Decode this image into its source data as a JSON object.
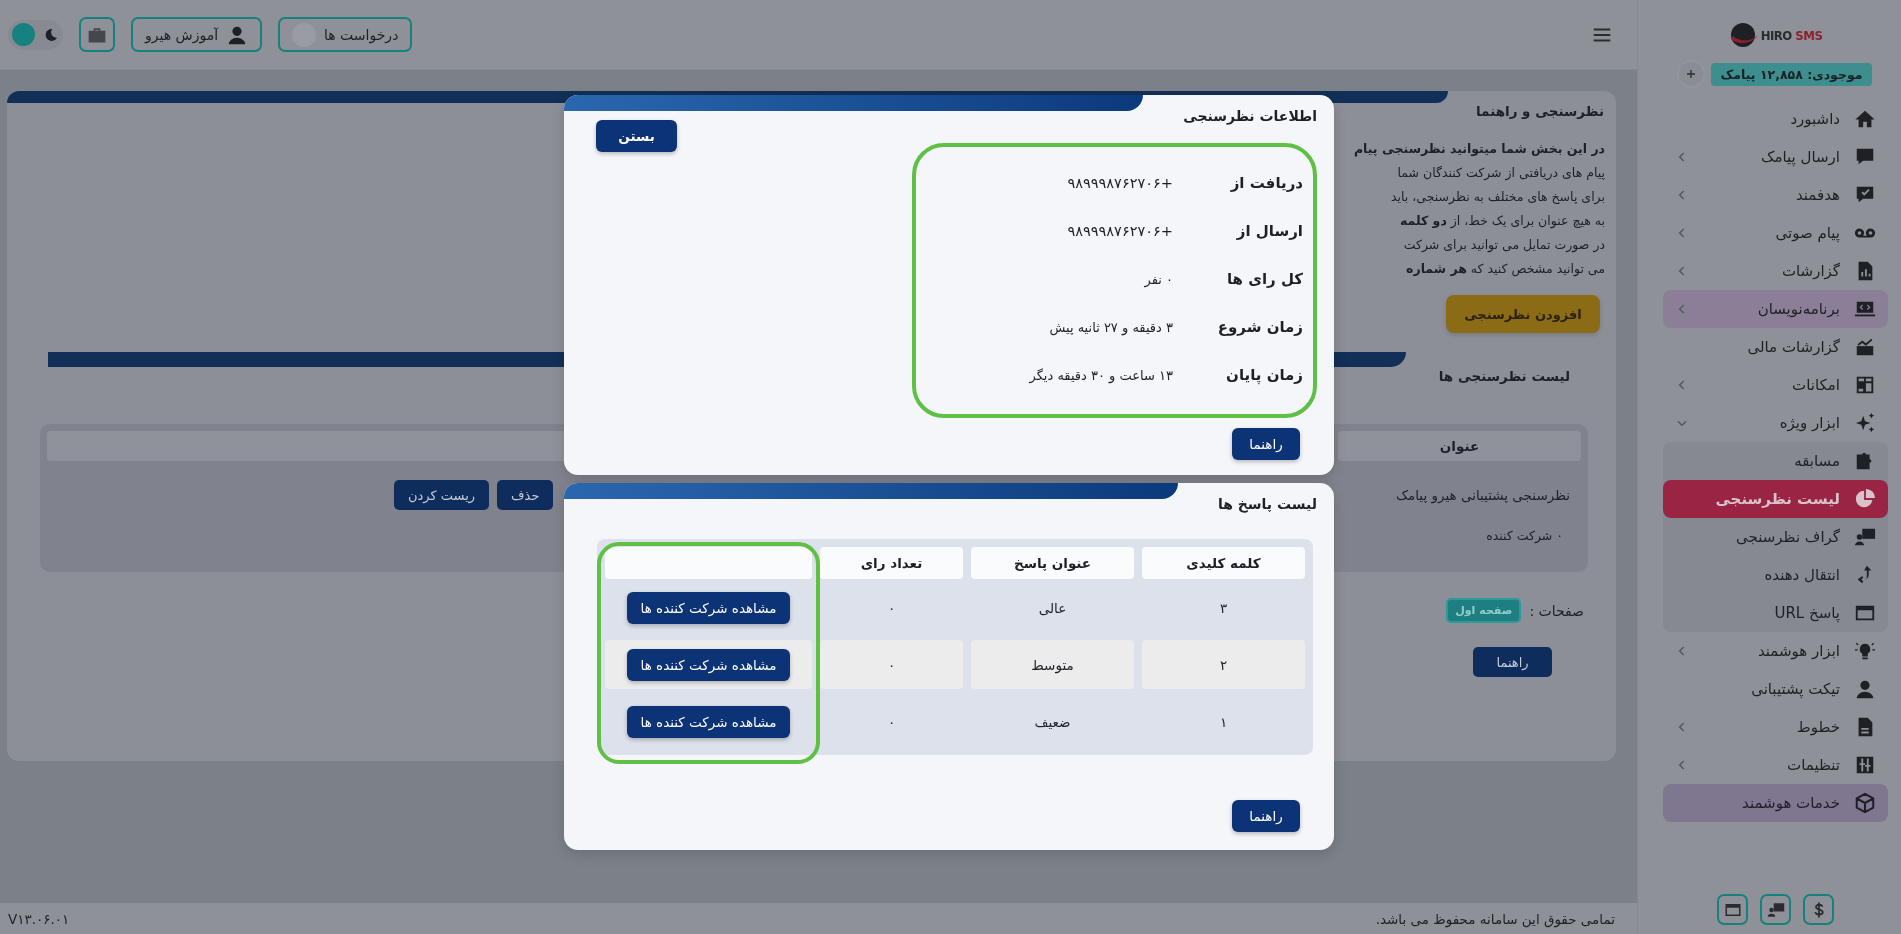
{
  "topbar": {
    "theme_toggle_on": false,
    "requests_button": "درخواست ها",
    "tutorial_button": "آموزش هیرو"
  },
  "sidebar": {
    "brand": "HIRO",
    "brand_accent": "SMS",
    "balance": "موجودی: ۱۲,۸۵۸ پیامک",
    "items": [
      {
        "label": "داشبورد",
        "has_submenu": false,
        "selected": false,
        "highlighted": false
      },
      {
        "label": "ارسال پیامک",
        "has_submenu": true,
        "expanded": false,
        "selected": false,
        "highlighted": false
      },
      {
        "label": "هدفمند",
        "has_submenu": true,
        "expanded": false,
        "selected": false,
        "highlighted": false
      },
      {
        "label": "پیام صوتی",
        "has_submenu": true,
        "expanded": false,
        "selected": false,
        "highlighted": false
      },
      {
        "label": "گزارشات",
        "has_submenu": true,
        "expanded": false,
        "selected": false,
        "highlighted": false
      },
      {
        "label": "برنامه‌نویسان",
        "has_submenu": true,
        "expanded": false,
        "selected": false,
        "highlighted": true
      },
      {
        "label": "گزارشات مالی",
        "has_submenu": false,
        "selected": false,
        "highlighted": false
      },
      {
        "label": "امکانات",
        "has_submenu": true,
        "expanded": false,
        "selected": false,
        "highlighted": false
      },
      {
        "label": "ابزار ویژه",
        "has_submenu": true,
        "expanded": true,
        "selected": false,
        "highlighted": false,
        "children": [
          {
            "label": "مسابقه",
            "selected": false
          },
          {
            "label": "لیست نظرسنجی",
            "selected": true
          },
          {
            "label": "گراف نظرسنجی",
            "selected": false
          },
          {
            "label": "انتقال دهنده",
            "selected": false
          },
          {
            "label": "پاسخ URL",
            "selected": false
          }
        ]
      },
      {
        "label": "ابزار هوشمند",
        "has_submenu": true,
        "expanded": false,
        "selected": false,
        "highlighted": false
      },
      {
        "label": "تیکت پشتیبانی",
        "has_submenu": false,
        "selected": false,
        "highlighted": false
      },
      {
        "label": "خطوط",
        "has_submenu": true,
        "expanded": false,
        "selected": false,
        "highlighted": false
      },
      {
        "label": "تنظیمات",
        "has_submenu": true,
        "expanded": false,
        "selected": false,
        "highlighted": false
      },
      {
        "label": "خدمات هوشمند",
        "has_submenu": false,
        "selected": false,
        "highlighted": true
      }
    ]
  },
  "page": {
    "title": "نظرسنجی و راهنما",
    "intro_lines": [
      "**در این بخش شما میتوانید نظرسنجی پیام**",
      "پیام های دریافتی از شرکت کنندگان شما",
      "برای پاسخ های مختلف به نظرسنجی، باید",
      "به هیچ عنوان برای یک خط، از **دو کلمه**",
      "در صورت تمایل می توانید برای شرکت",
      "می توانید مشخص کنید که **هر شماره**"
    ],
    "add_button": "افزودن نظرسنجی",
    "polls_title": "لیست نظرسنجی ها",
    "polls_columns": [
      "عنوان"
    ],
    "polls": [
      {
        "title": "نظرسنجی پشتیبانی هیرو پیامک",
        "actions": [
          "حذف",
          "ریست کردن"
        ],
        "participants": "۰ شرکت کننده"
      }
    ],
    "pagination_label": "صفحات :",
    "pages": [
      {
        "label": "صفحه اول",
        "selected": true
      }
    ],
    "help_button": "راهنما"
  },
  "info_modal": {
    "title": "اطلاعات نظرسنجی",
    "close_button": "بستن",
    "highlighted": true,
    "fields": [
      {
        "label": "دریافت از",
        "value": "+۹۸۹۹۹۸۷۶۲۷۰۶"
      },
      {
        "label": "ارسال از",
        "value": "+۹۸۹۹۹۸۷۶۲۷۰۶"
      },
      {
        "label": "کل رای ها",
        "value": "۰ نفر"
      },
      {
        "label": "زمان شروع",
        "value": "۳ دقیقه و ۲۷ ثانیه پیش"
      },
      {
        "label": "زمان پایان",
        "value": "۱۳ ساعت و ۳۰ دقیقه دیگر"
      }
    ],
    "help_button": "راهنما"
  },
  "answers_modal": {
    "title": "لیست پاسخ ها",
    "actions_highlighted": true,
    "columns": [
      "کلمه کلیدی",
      "عنوان پاسخ",
      "تعداد رای"
    ],
    "rows": [
      {
        "keyword": "۳",
        "title": "عالی",
        "votes": "۰",
        "action": "مشاهده شرکت کننده ها"
      },
      {
        "keyword": "۲",
        "title": "متوسط",
        "votes": "۰",
        "action": "مشاهده شرکت کننده ها"
      },
      {
        "keyword": "۱",
        "title": "ضعیف",
        "votes": "۰",
        "action": "مشاهده شرکت کننده ها"
      }
    ],
    "help_button": "راهنما"
  },
  "footer": {
    "copyright": "تمامی حقوق این سامانه محفوظ می باشد.",
    "version": "V۱۳.۰۶.۰۱"
  }
}
